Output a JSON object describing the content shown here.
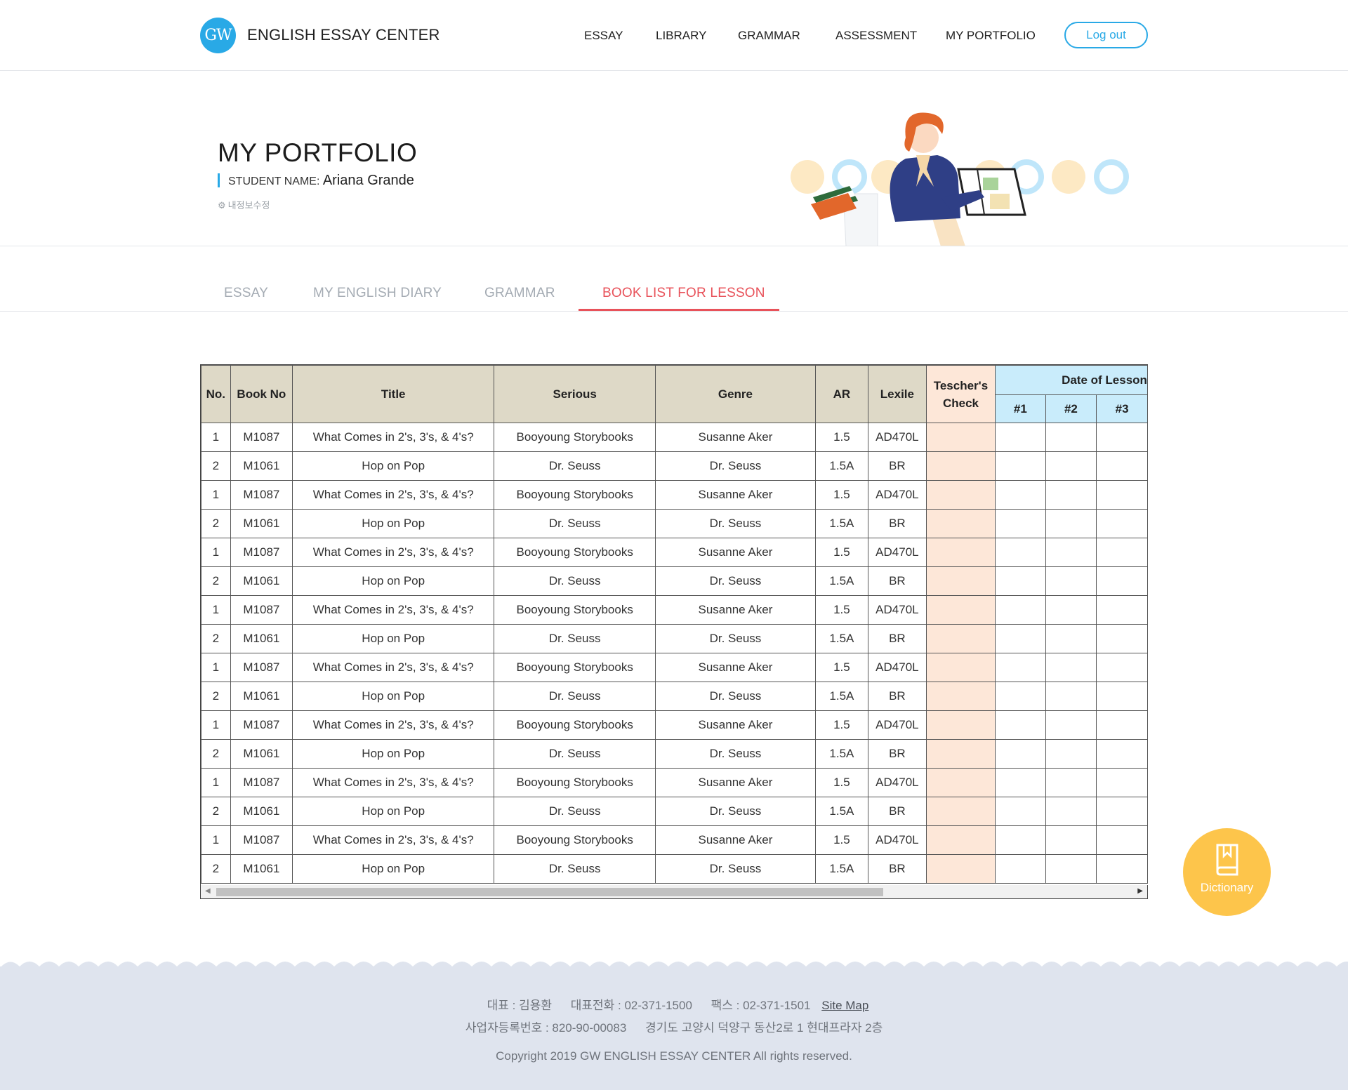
{
  "header": {
    "logo_text": "GW",
    "brand": "ENGLISH ESSAY CENTER",
    "nav": [
      "ESSAY",
      "LIBRARY",
      "GRAMMAR",
      "ASSESSMENT",
      "MY PORTFOLIO"
    ],
    "logout_label": "Log out"
  },
  "hero": {
    "title": "MY PORTFOLIO",
    "student_label": "STUDENT NAME:",
    "student_name": "Ariana Grande",
    "edit_link": "내정보수정"
  },
  "tabs": [
    "ESSAY",
    "MY ENGLISH DIARY",
    "GRAMMAR",
    "BOOK LIST FOR LESSON"
  ],
  "active_tab": "BOOK LIST FOR LESSON",
  "table": {
    "headers": [
      "No.",
      "Book No",
      "Title",
      "Serious",
      "Genre",
      "AR",
      "Lexile",
      "Tescher's Check",
      "Date of Lesson"
    ],
    "date_subheaders": [
      "#1",
      "#2",
      "#3"
    ],
    "rows": [
      [
        "1",
        "M1087",
        "What Comes in 2's, 3's, & 4's?",
        "Booyoung Storybooks",
        "Susanne Aker",
        "1.5",
        "AD470L"
      ],
      [
        "2",
        "M1061",
        "Hop on Pop",
        "Dr. Seuss",
        "Dr. Seuss",
        "1.5A",
        "BR"
      ],
      [
        "1",
        "M1087",
        "What Comes in 2's, 3's, & 4's?",
        "Booyoung Storybooks",
        "Susanne Aker",
        "1.5",
        "AD470L"
      ],
      [
        "2",
        "M1061",
        "Hop on Pop",
        "Dr. Seuss",
        "Dr. Seuss",
        "1.5A",
        "BR"
      ],
      [
        "1",
        "M1087",
        "What Comes in 2's, 3's, & 4's?",
        "Booyoung Storybooks",
        "Susanne Aker",
        "1.5",
        "AD470L"
      ],
      [
        "2",
        "M1061",
        "Hop on Pop",
        "Dr. Seuss",
        "Dr. Seuss",
        "1.5A",
        "BR"
      ],
      [
        "1",
        "M1087",
        "What Comes in 2's, 3's, & 4's?",
        "Booyoung Storybooks",
        "Susanne Aker",
        "1.5",
        "AD470L"
      ],
      [
        "2",
        "M1061",
        "Hop on Pop",
        "Dr. Seuss",
        "Dr. Seuss",
        "1.5A",
        "BR"
      ],
      [
        "1",
        "M1087",
        "What Comes in 2's, 3's, & 4's?",
        "Booyoung Storybooks",
        "Susanne Aker",
        "1.5",
        "AD470L"
      ],
      [
        "2",
        "M1061",
        "Hop on Pop",
        "Dr. Seuss",
        "Dr. Seuss",
        "1.5A",
        "BR"
      ],
      [
        "1",
        "M1087",
        "What Comes in 2's, 3's, & 4's?",
        "Booyoung Storybooks",
        "Susanne Aker",
        "1.5",
        "AD470L"
      ],
      [
        "2",
        "M1061",
        "Hop on Pop",
        "Dr. Seuss",
        "Dr. Seuss",
        "1.5A",
        "BR"
      ],
      [
        "1",
        "M1087",
        "What Comes in 2's, 3's, & 4's?",
        "Booyoung Storybooks",
        "Susanne Aker",
        "1.5",
        "AD470L"
      ],
      [
        "2",
        "M1061",
        "Hop on Pop",
        "Dr. Seuss",
        "Dr. Seuss",
        "1.5A",
        "BR"
      ],
      [
        "1",
        "M1087",
        "What Comes in 2's, 3's, & 4's?",
        "Booyoung Storybooks",
        "Susanne Aker",
        "1.5",
        "AD470L"
      ],
      [
        "2",
        "M1061",
        "Hop on Pop",
        "Dr. Seuss",
        "Dr. Seuss",
        "1.5A",
        "BR"
      ]
    ]
  },
  "dictionary": {
    "label": "Dictionary",
    "icon": "book-icon"
  },
  "footer": {
    "line1": [
      "대표 : 김용환",
      "대표전화 : 02-371-1500",
      "팩스 : 02-371-1501"
    ],
    "sitemap": "Site Map",
    "line2": [
      "사업자등록번호 : 820-90-00083",
      "경기도 고양시 덕양구 동산2로 1 현대프라자 2층"
    ],
    "copyright": "Copyright 2019 GW ENGLISH ESSAY CENTER All rights reserved."
  },
  "colors": {
    "accent_blue": "#29a9e6",
    "active_red": "#e8525a",
    "header_beige": "#ded9c7",
    "check_peach": "#fde7d8",
    "date_blue": "#c9ecfb",
    "dictionary_yellow": "#fdc54b",
    "footer_bg": "#dfe4ee"
  }
}
